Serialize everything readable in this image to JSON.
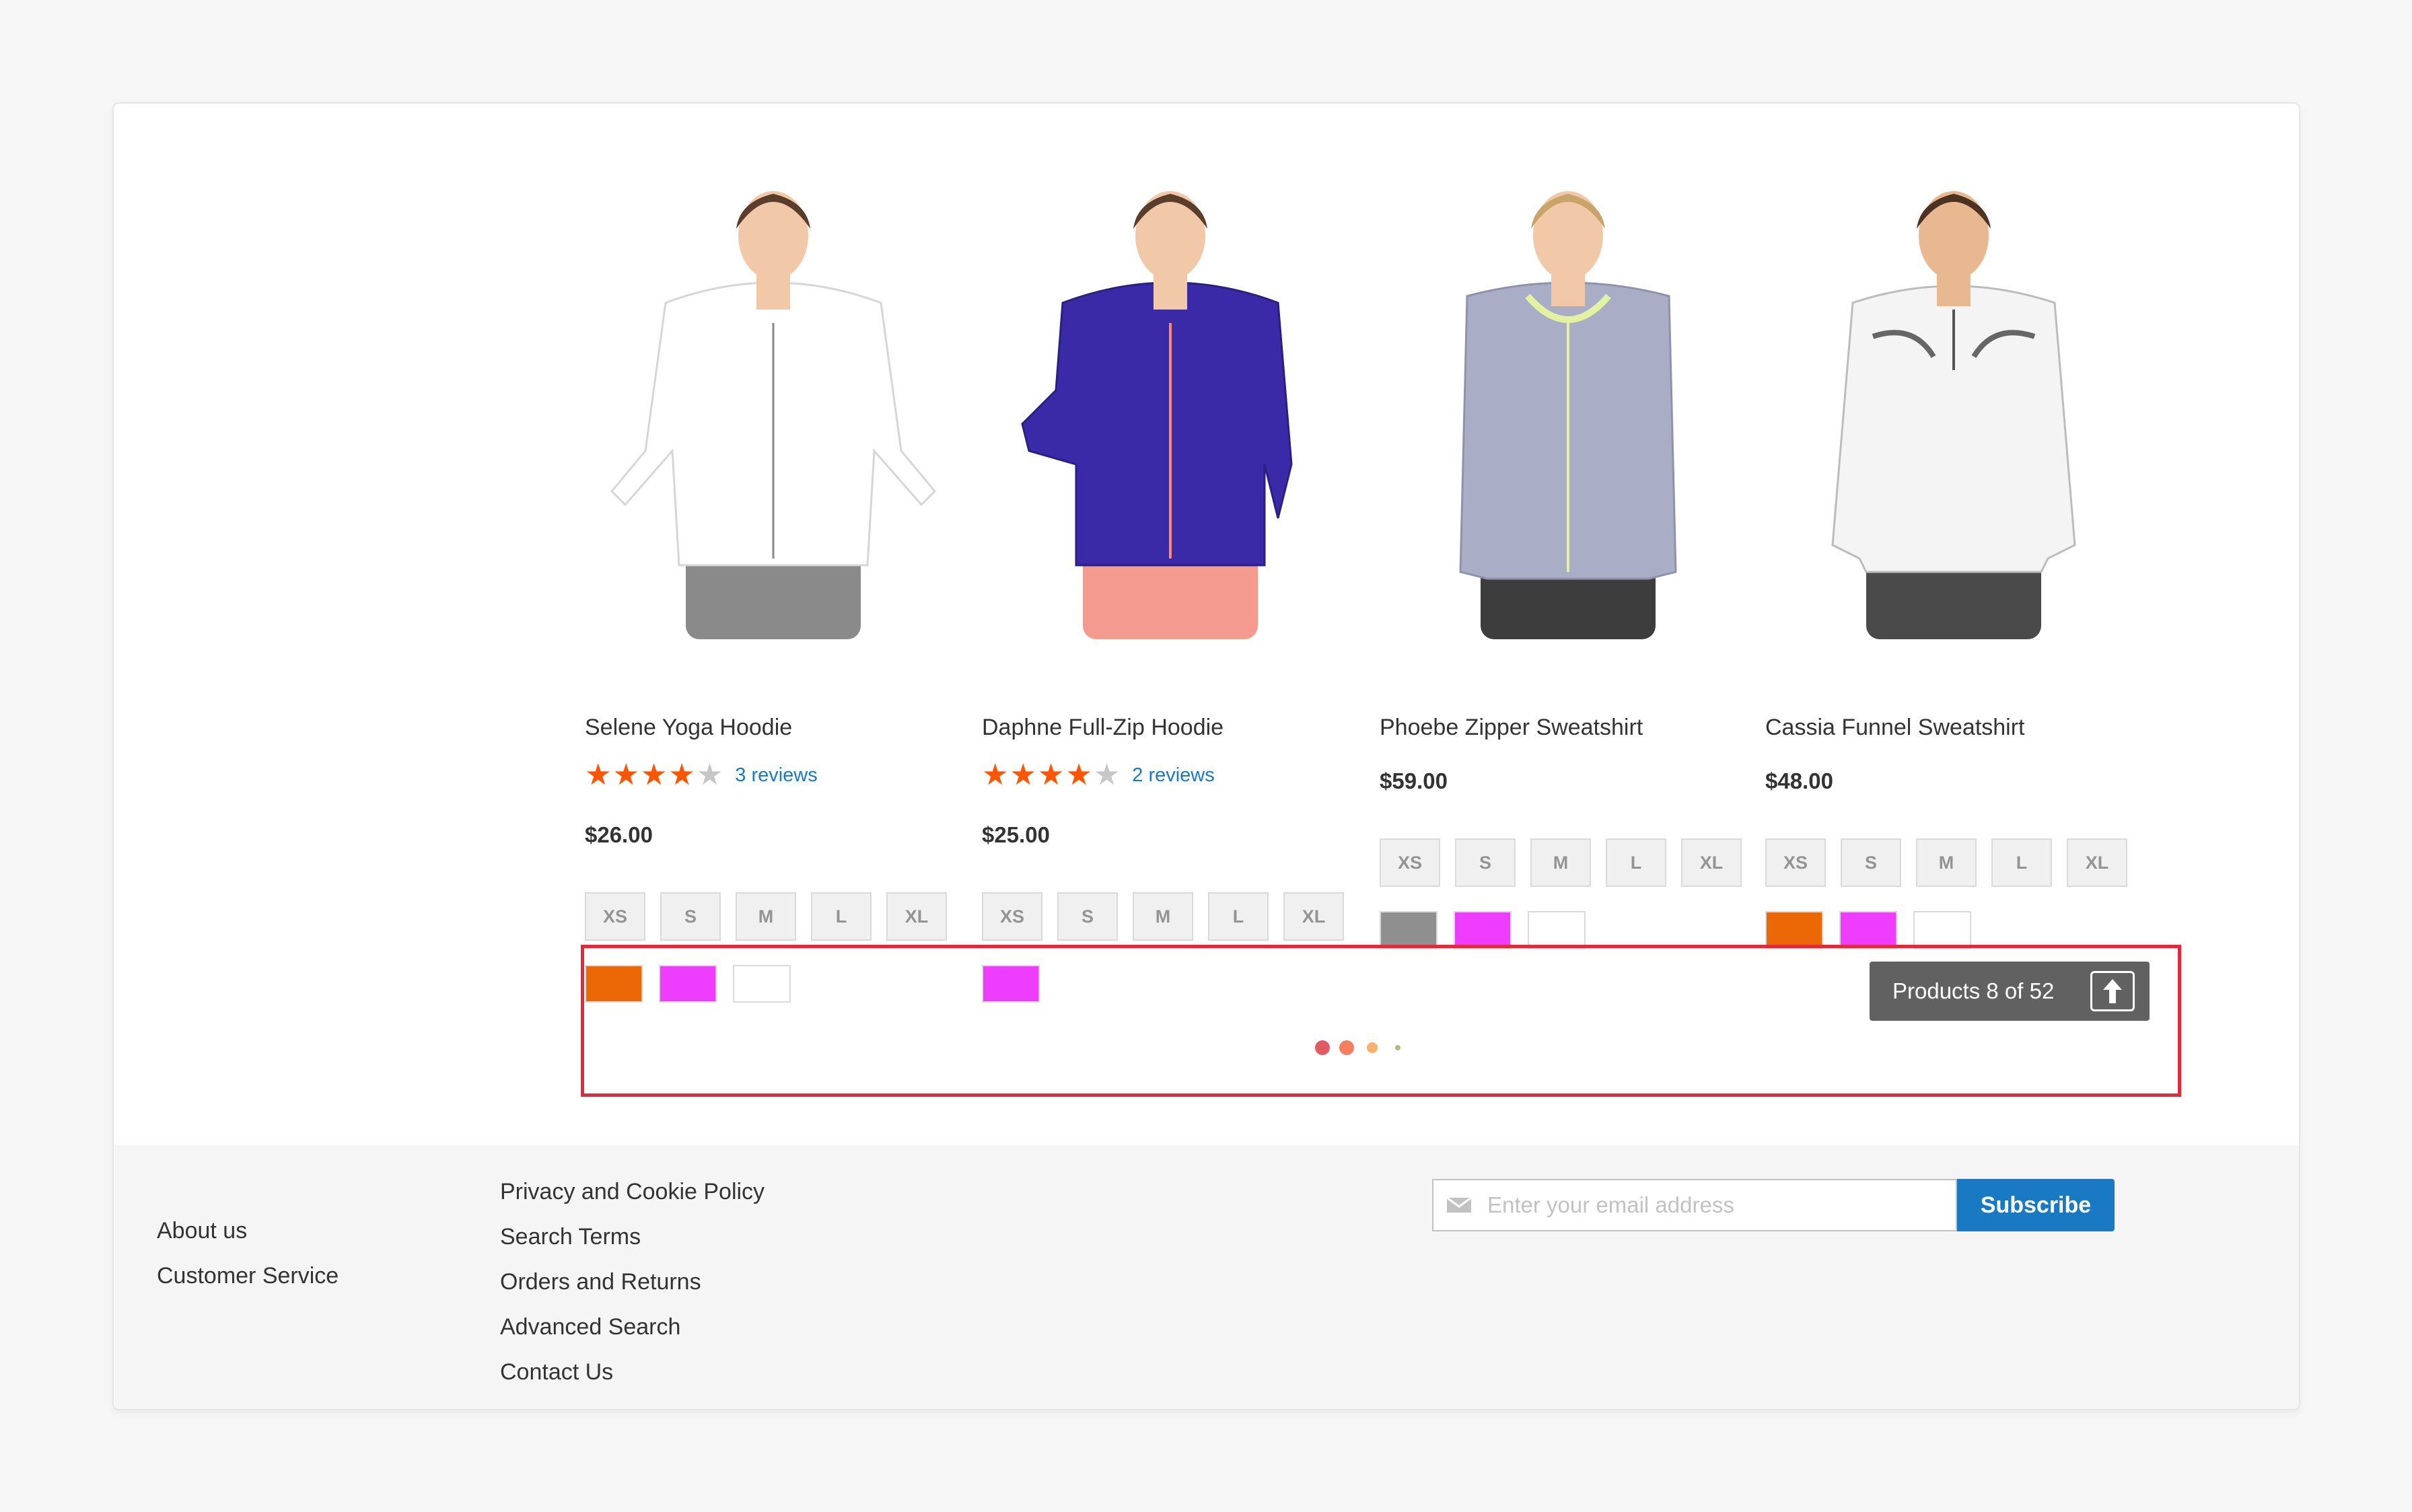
{
  "products": [
    {
      "name": "Selene Yoga Hoodie",
      "rating": 4,
      "reviews": "3 reviews",
      "price": "$26.00",
      "sizes": [
        "XS",
        "S",
        "M",
        "L",
        "XL"
      ],
      "colors": [
        "#ec6706",
        "#ef3dff",
        "#ffffff"
      ],
      "jacket": "#ffffff",
      "pants": "#8a8a8a"
    },
    {
      "name": "Daphne Full-Zip Hoodie",
      "rating": 4,
      "reviews": "2 reviews",
      "price": "$25.00",
      "sizes": [
        "XS",
        "S",
        "M",
        "L",
        "XL"
      ],
      "colors": [
        "#ef3dff"
      ],
      "jacket": "#3b2aa8",
      "pants": "#f59a8f"
    },
    {
      "name": "Phoebe Zipper Sweatshirt",
      "rating": null,
      "reviews": "",
      "price": "$59.00",
      "sizes": [
        "XS",
        "S",
        "M",
        "L",
        "XL"
      ],
      "colors": [
        "#8f8f8f",
        "#ef3dff",
        "#ffffff"
      ],
      "jacket": "#a9aec6",
      "pants": "#3d3d3d"
    },
    {
      "name": "Cassia Funnel Sweatshirt",
      "rating": null,
      "reviews": "",
      "price": "$48.00",
      "sizes": [
        "XS",
        "S",
        "M",
        "L",
        "XL"
      ],
      "colors": [
        "#ec6706",
        "#ef3dff",
        "#ffffff"
      ],
      "jacket": "#f4f4f4",
      "pants": "#4a4a4a"
    }
  ],
  "loader": {
    "counter_text": "Products 8 of 52",
    "dot_colors": [
      "#e15b64",
      "#f47e60",
      "#f8b26a",
      "#abbd81"
    ]
  },
  "footer": {
    "col1": [
      "About us",
      "Customer Service"
    ],
    "col2": [
      "Privacy and Cookie Policy",
      "Search Terms",
      "Orders and Returns",
      "Advanced Search",
      "Contact Us"
    ],
    "newsletter": {
      "placeholder": "Enter your email address",
      "button_label": "Subscribe"
    }
  },
  "colors": {
    "accent_blue": "#1979c3",
    "star_on": "#ff5501",
    "highlight_border": "#e02b3c"
  }
}
